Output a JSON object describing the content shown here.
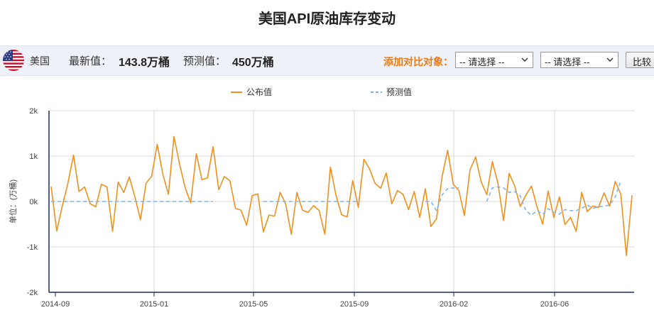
{
  "title": "美国API原油库存变动",
  "info": {
    "country": "美国",
    "latest_label": "最新值：",
    "latest_value": "143.8万桶",
    "forecast_label": "预测值：",
    "forecast_value": "450万桶",
    "compare_label": "添加对比对象：",
    "select1": "-- 请选择 --",
    "select2": "-- 请选择 --",
    "compare_button": "比较"
  },
  "colors": {
    "published": "#f0901c",
    "forecast": "#7cb5ec",
    "axis": "#1a2a5a",
    "grid": "#d8d8d8",
    "flag_red": "#c8102e",
    "flag_blue": "#2b3a80"
  },
  "icons": {
    "flag": "us-flag-icon",
    "dropdown": "chevron-down-icon"
  },
  "chart_data": {
    "type": "line",
    "legend": [
      "公布值",
      "预测值"
    ],
    "legend_position": "top-center",
    "ylabel": "单位：(万桶)",
    "ylim": [
      -2000,
      2000
    ],
    "y_ticks": [
      "2k",
      "1k",
      "0k",
      "-1k",
      "-2k"
    ],
    "x_tick_labels": [
      "2014-09",
      "2015-01",
      "2015-05",
      "2015-09",
      "2016-02",
      "2016-06"
    ],
    "grid": true,
    "series": [
      {
        "name": "公布值",
        "values": [
          330,
          -650,
          -100,
          400,
          1020,
          220,
          320,
          -50,
          -120,
          380,
          320,
          -660,
          430,
          200,
          540,
          100,
          -400,
          400,
          560,
          1260,
          600,
          160,
          1430,
          820,
          300,
          -30,
          1050,
          480,
          520,
          1210,
          260,
          550,
          460,
          -150,
          -190,
          -520,
          130,
          170,
          -670,
          -300,
          -320,
          200,
          -50,
          -720,
          200,
          -190,
          -240,
          -90,
          -200,
          -720,
          760,
          140,
          -290,
          -340,
          460,
          -130,
          930,
          720,
          400,
          290,
          630,
          -50,
          240,
          160,
          -180,
          220,
          -350,
          280,
          -550,
          -380,
          550,
          1130,
          380,
          240,
          -310,
          700,
          980,
          430,
          150,
          880,
          400,
          -420,
          620,
          340,
          -110,
          140,
          340,
          -120,
          -500,
          230,
          -350,
          100,
          -510,
          -350,
          -660,
          200,
          -220,
          -100,
          -130,
          190,
          -100,
          440,
          160,
          -1190,
          138
        ]
      },
      {
        "name": "预测值",
        "values": [
          0,
          0,
          0,
          0,
          0,
          0,
          0,
          0,
          0,
          0,
          0,
          0,
          0,
          0,
          0,
          0,
          0,
          0,
          0,
          0,
          0,
          0,
          0,
          0,
          0,
          0,
          0,
          0,
          0,
          0,
          null,
          null,
          null,
          null,
          null,
          null,
          null,
          null,
          0,
          0,
          0,
          0,
          0,
          0,
          0,
          0,
          0,
          0,
          0,
          0,
          0,
          0,
          0,
          0,
          0,
          0,
          null,
          null,
          null,
          null,
          null,
          null,
          null,
          null,
          null,
          null,
          null,
          0,
          0,
          -200,
          150,
          280,
          300,
          300,
          null,
          null,
          null,
          null,
          0,
          300,
          320,
          300,
          200,
          220,
          120,
          -200,
          -300,
          -200,
          -280,
          -160,
          -240,
          -280,
          -180,
          -200,
          -200,
          -150,
          -80,
          -150,
          -120,
          -100,
          -80,
          100,
          450
        ]
      }
    ]
  }
}
